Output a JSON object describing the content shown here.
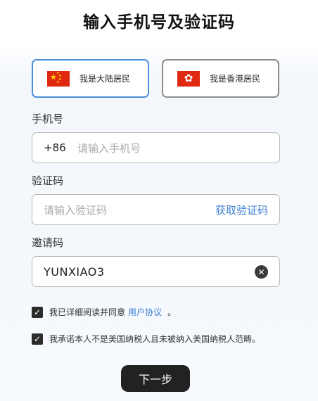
{
  "page": {
    "title": "输入手机号及验证码"
  },
  "regions": [
    {
      "label": "我是大陆居民",
      "flag": "china-flag-icon",
      "selected": true
    },
    {
      "label": "我是香港居民",
      "flag": "hong-kong-flag-icon",
      "selected": false
    }
  ],
  "phone": {
    "label": "手机号",
    "prefix": "+86",
    "placeholder": "请输入手机号",
    "value": ""
  },
  "code": {
    "label": "验证码",
    "placeholder": "请输入验证码",
    "value": "",
    "get_code_label": "获取验证码"
  },
  "invite": {
    "label": "邀请码",
    "value": "YUNXIAO3",
    "clear_icon": "clear-icon"
  },
  "agreements": [
    {
      "text": "我已详细阅读并同意",
      "link": "用户协议",
      "suffix": "。",
      "checked": true
    },
    {
      "text": "我承诺本人不是美国纳税人且未被纳入美国纳税人范畴。",
      "checked": true
    }
  ],
  "next_button": {
    "label": "下一步"
  },
  "colors": {
    "accent": "#3c7fd0",
    "selected_border": "#4a8fd8",
    "button_bg": "#222222"
  }
}
